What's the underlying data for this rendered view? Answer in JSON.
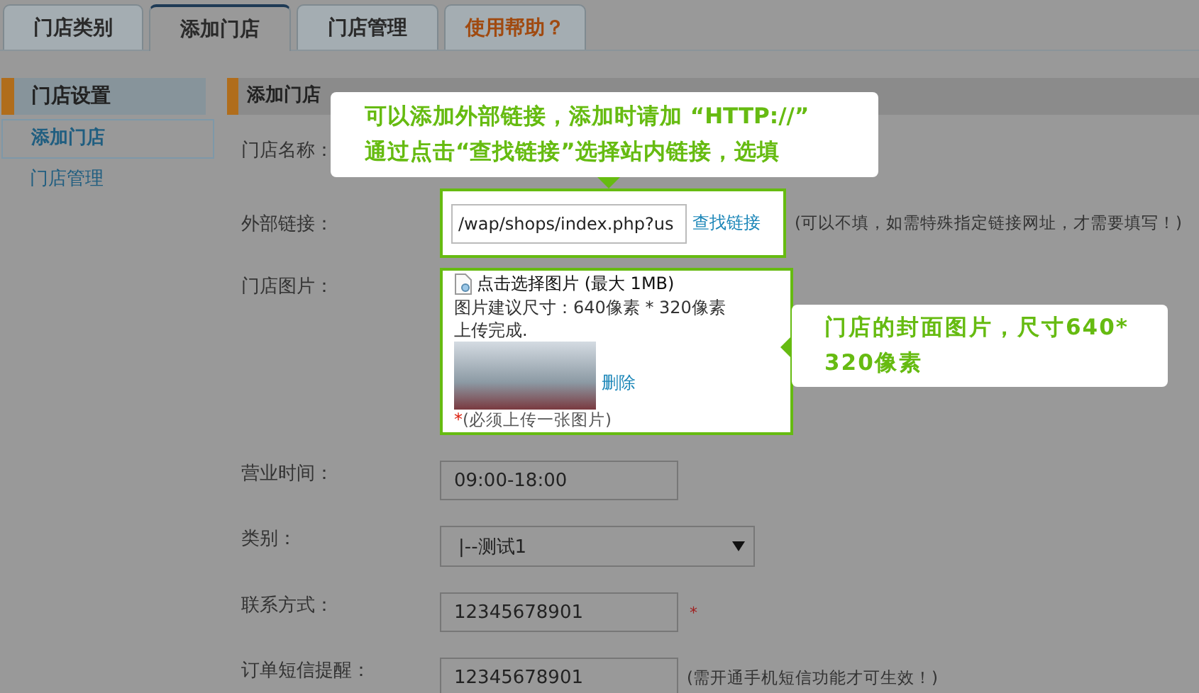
{
  "tabs": [
    {
      "label": "门店类别",
      "selected": false,
      "kind": "normal"
    },
    {
      "label": "添加门店",
      "selected": true,
      "kind": "normal"
    },
    {
      "label": "门店管理",
      "selected": false,
      "kind": "normal"
    },
    {
      "label": "使用帮助？",
      "selected": false,
      "kind": "help"
    }
  ],
  "sidebar": {
    "heading": "门店设置",
    "items": [
      {
        "label": "添加门店",
        "selected": true
      },
      {
        "label": "门店管理",
        "selected": false
      }
    ]
  },
  "section_title": "添加门店",
  "fields": [
    {
      "kind": "name",
      "label": "门店名称："
    },
    {
      "kind": "link",
      "label": "外部链接：",
      "value": "/wap/shops/index.php?us",
      "button": "查找链接",
      "note": "(可以不填，如需特殊指定链接网址，才需要填写！)",
      "highlighted": true
    },
    {
      "kind": "image",
      "label": "门店图片：",
      "upload": "点击选择图片 (最大 1MB)",
      "hint": "图片建议尺寸：640像素 * 320像素",
      "status": "上传完成.",
      "delete": "删除",
      "required_mark": "*",
      "note": "(必须上传一张图片)",
      "highlighted": true
    },
    {
      "kind": "text",
      "label": "营业时间：",
      "value": "09:00-18:00"
    },
    {
      "kind": "select",
      "label": "类别：",
      "value": "|--测试1"
    },
    {
      "kind": "text",
      "label": "联系方式：",
      "value": "12345678901",
      "required_mark": "*"
    },
    {
      "kind": "text",
      "label": "订单短信提醒：",
      "value": "12345678901",
      "note": "(需开通手机短信功能才可生效！)"
    }
  ],
  "callouts": [
    {
      "kind": "down",
      "lines": [
        "可以添加外部链接，添加时请加 “HTTP://”",
        "通过点击“查找链接”选择站内链接，选填"
      ]
    },
    {
      "kind": "left",
      "lines": [
        "门店的封面图片，尺寸640*",
        "320像素"
      ]
    }
  ]
}
